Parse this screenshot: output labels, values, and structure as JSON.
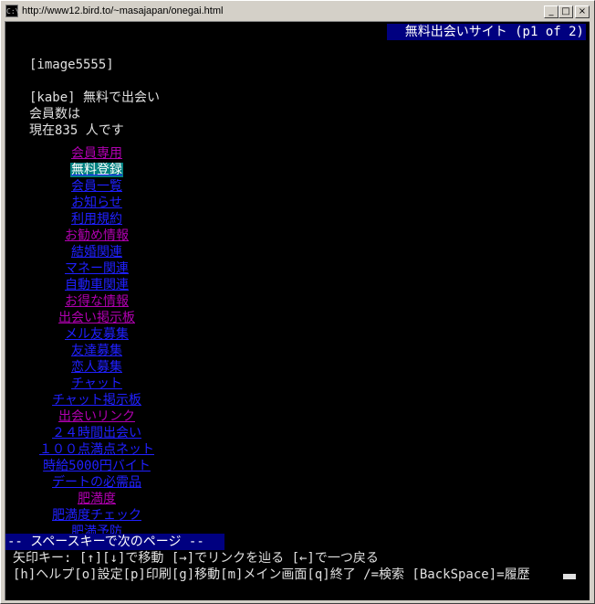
{
  "window": {
    "title": "http://www12.bird.to/~masajapan/onegai.html",
    "icon_label": "C:\\",
    "minimize_symbol": "_",
    "maximize_symbol": "□",
    "close_symbol": "×"
  },
  "header": {
    "page_title": "無料出会いサイト (p1 of 2)"
  },
  "content": {
    "image_placeholder": "[image5555]",
    "line1": "[kabe] 無料で出会い",
    "line2": "会員数は",
    "line3": "現在835 人です"
  },
  "links": [
    {
      "label": "会員専用",
      "color": "purple",
      "selected": false
    },
    {
      "label": "無料登録",
      "color": "blue",
      "selected": true
    },
    {
      "label": "会員一覧",
      "color": "blue",
      "selected": false
    },
    {
      "label": "お知らせ",
      "color": "blue",
      "selected": false
    },
    {
      "label": "利用規約",
      "color": "blue",
      "selected": false
    },
    {
      "label": "お勧め情報",
      "color": "purple",
      "selected": false
    },
    {
      "label": "結婚関連",
      "color": "blue",
      "selected": false
    },
    {
      "label": "マネー関連",
      "color": "blue",
      "selected": false
    },
    {
      "label": "自動車関連",
      "color": "blue",
      "selected": false
    },
    {
      "label": "お得な情報",
      "color": "purple",
      "selected": false
    },
    {
      "label": "出会い掲示板",
      "color": "purple",
      "selected": false
    },
    {
      "label": "メル友募集",
      "color": "blue",
      "selected": false
    },
    {
      "label": "友達募集",
      "color": "blue",
      "selected": false
    },
    {
      "label": "恋人募集",
      "color": "blue",
      "selected": false
    },
    {
      "label": "チャット",
      "color": "blue",
      "selected": false
    },
    {
      "label": "チャット掲示板",
      "color": "blue",
      "selected": false
    },
    {
      "label": "出会いリンク",
      "color": "purple",
      "selected": false
    },
    {
      "label": "２４時間出会い",
      "color": "blue",
      "selected": false
    },
    {
      "label": "１００点満点ネット",
      "color": "blue",
      "selected": false
    },
    {
      "label": "時給5000円バイト",
      "color": "blue",
      "selected": false
    },
    {
      "label": "デートの必需品",
      "color": "blue",
      "selected": false
    },
    {
      "label": "肥満度",
      "color": "purple",
      "selected": false
    },
    {
      "label": "肥満度チェック",
      "color": "blue",
      "selected": false
    },
    {
      "label": "肥満予防",
      "color": "blue",
      "selected": false
    }
  ],
  "footer": {
    "more_prompt": "-- スペースキーで次のページ --",
    "help_line1": "  矢印キー: [↑][↓]で移動 [→]でリンクを辿る [←]で一つ戻る",
    "help_line2": "[h]ヘルプ[o]設定[p]印刷[g]移動[m]メイン画面[q]終了 /=検索 [BackSpace]=履歴"
  },
  "colors": {
    "background": "#000000",
    "text": "#e0e0e0",
    "link_blue": "#2020ff",
    "link_purple": "#b000b0",
    "selected_bg": "#008080",
    "status_bar": "#000080"
  }
}
